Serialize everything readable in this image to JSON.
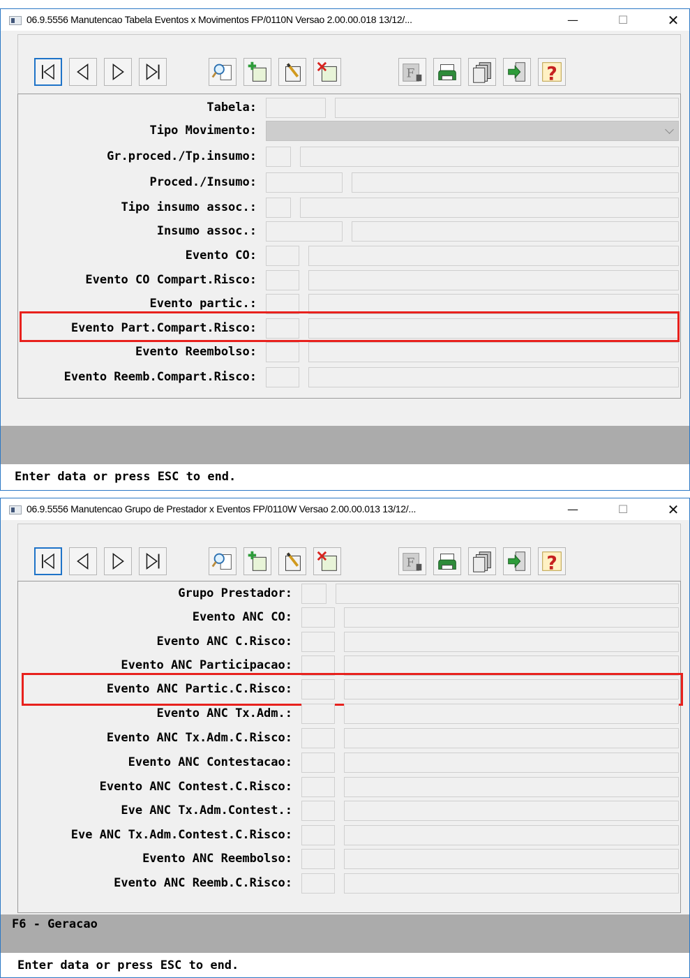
{
  "colors": {
    "title_border": "#2b78c5",
    "highlight": "#e8211d",
    "status_gray": "#ababab",
    "toolbar_active": "#1e73c8"
  },
  "window_controls": {
    "minimize": "—",
    "maximize": "☐",
    "close": "✕"
  },
  "toolbar_icons": [
    "first-record-icon",
    "previous-record-icon",
    "next-record-icon",
    "last-record-icon",
    "search-icon",
    "add-record-icon",
    "edit-record-icon",
    "delete-record-icon",
    "filter-icon",
    "print-icon",
    "copy-icon",
    "exit-icon",
    "help-icon"
  ],
  "windows": [
    {
      "title": "06.9.5556 Manutencao  Tabela Eventos x Movimentos FP/0110N Versao 2.00.00.018 13/12/...",
      "fields": [
        {
          "label": "Tabela:",
          "code": "",
          "desc": ""
        },
        {
          "label": "Tipo Movimento:",
          "value": ""
        },
        {
          "label": "Gr.proced./Tp.insumo:",
          "code": "",
          "desc": ""
        },
        {
          "label": "Proced./Insumo:",
          "code": "",
          "desc": ""
        },
        {
          "label": "Tipo insumo assoc.:",
          "code": "",
          "desc": ""
        },
        {
          "label": "Insumo assoc.:",
          "code": "",
          "desc": ""
        },
        {
          "label": "Evento CO:",
          "code": "",
          "desc": ""
        },
        {
          "label": "Evento CO Compart.Risco:",
          "code": "",
          "desc": ""
        },
        {
          "label": "Evento partic.:",
          "code": "",
          "desc": ""
        },
        {
          "label": "Evento Part.Compart.Risco:",
          "code": "",
          "desc": ""
        },
        {
          "label": "Evento Reembolso:",
          "code": "",
          "desc": ""
        },
        {
          "label": "Evento Reemb.Compart.Risco:",
          "code": "",
          "desc": ""
        }
      ],
      "function_keys": "",
      "status": "Enter data or press ESC to end."
    },
    {
      "title": "06.9.5556 Manutencao  Grupo de Prestador x Eventos FP/0110W Versao 2.00.00.013 13/12/...",
      "fields": [
        {
          "label": "Grupo Prestador:",
          "code": "",
          "desc": ""
        },
        {
          "label": "Evento ANC CO:",
          "code": "",
          "desc": ""
        },
        {
          "label": "Evento ANC C.Risco:",
          "code": "",
          "desc": ""
        },
        {
          "label": "Evento ANC Participacao:",
          "code": "",
          "desc": ""
        },
        {
          "label": "Evento ANC Partic.C.Risco:",
          "code": "",
          "desc": ""
        },
        {
          "label": "Evento ANC Tx.Adm.:",
          "code": "",
          "desc": ""
        },
        {
          "label": "Evento ANC Tx.Adm.C.Risco:",
          "code": "",
          "desc": ""
        },
        {
          "label": "Evento ANC Contestacao:",
          "code": "",
          "desc": ""
        },
        {
          "label": "Evento ANC Contest.C.Risco:",
          "code": "",
          "desc": ""
        },
        {
          "label": "Eve ANC Tx.Adm.Contest.:",
          "code": "",
          "desc": ""
        },
        {
          "label": "Eve ANC Tx.Adm.Contest.C.Risco:",
          "code": "",
          "desc": ""
        },
        {
          "label": "Evento ANC Reembolso:",
          "code": "",
          "desc": ""
        },
        {
          "label": "Evento ANC Reemb.C.Risco:",
          "code": "",
          "desc": ""
        }
      ],
      "function_keys": "F6 - Geracao",
      "status": "Enter data or press ESC to end."
    }
  ]
}
